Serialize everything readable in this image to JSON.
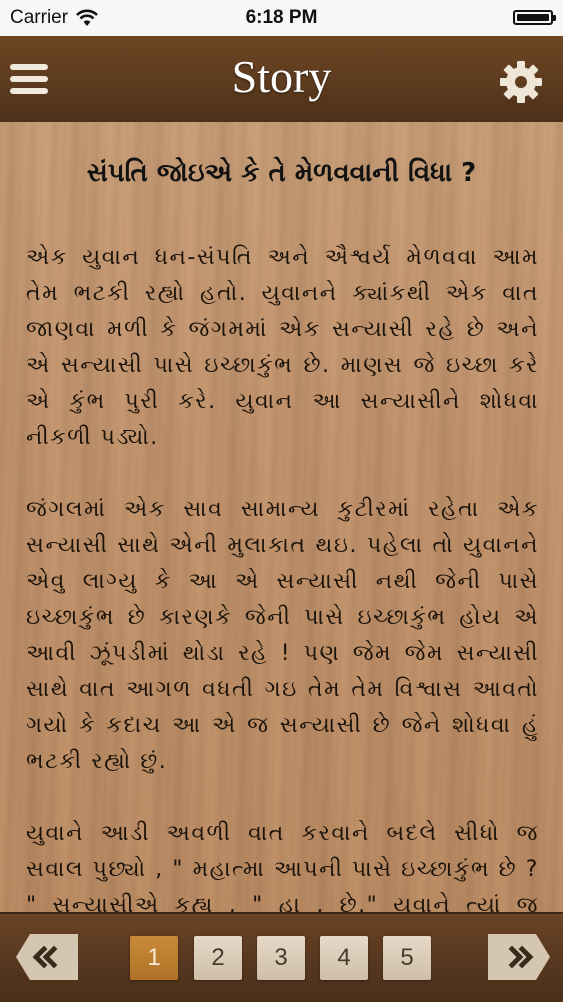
{
  "status_bar": {
    "carrier": "Carrier",
    "time": "6:18 PM"
  },
  "navbar": {
    "title": "Story",
    "menu_icon": "hamburger-menu-icon",
    "settings_icon": "gear-icon"
  },
  "story": {
    "title": "સંપતિ જોઇએ કે તે મેળવવાની વિધા ?",
    "paragraphs": [
      "એક યુવાન ધન-સંપતિ અને ઐશ્વર્ય મેળવવા આમ તેમ ભટકી રહ્યો હતો. યુવાનને ક્યાંકથી એક વાત જાણવા મળી કે જંગમમાં એક સન્યાસી રહે છે અને એ સન્યાસી પાસે ઇચ્છાકુંભ છે. માણસ જે ઇચ્છા કરે એ કુંભ પુરી કરે. યુવાન આ સન્યાસીને શોધવા નીકળી પડ્યો.",
      "જંગલમાં એક સાવ સામાન્ય કુટીરમાં રહેતા એક સન્યાસી સાથે એની મુલાકાત થઇ. પહેલા તો યુવાનને એવુ લાગ્યુ કે આ એ સન્યાસી નથી જેની પાસે ઇચ્છાકુંભ છે કારણકે જેની પાસે ઇચ્છાકુંભ હોય એ આવી ઝૂંપડીમાં થોડા રહે ! પણ જેમ જેમ સન્યાસી સાથે વાત આગળ વધતી ગઇ તેમ તેમ વિશ્વાસ આવતો ગયો કે કદાચ આ એ જ સન્યાસી છે જેને શોધવા હું ભટકી રહ્યો છું.",
      "યુવાને આડી અવળી વાત કરવાને બદલે સીધો જ સવાલ પુછ્યો , \" મહાત્મા આપની પાસે ઇચ્છાકુંભ છે ? \" સન્યાસીએ કહ્યુ , \" હા , છે.\" યુવાને ત્યાં જ રોકાઇને"
    ]
  },
  "pagination": {
    "prev_label": "«",
    "next_label": "»",
    "pages": [
      "1",
      "2",
      "3",
      "4",
      "5"
    ],
    "active_page": 1
  },
  "colors": {
    "accent_active_page": "#b07227",
    "bar": "#5b3a1e"
  }
}
